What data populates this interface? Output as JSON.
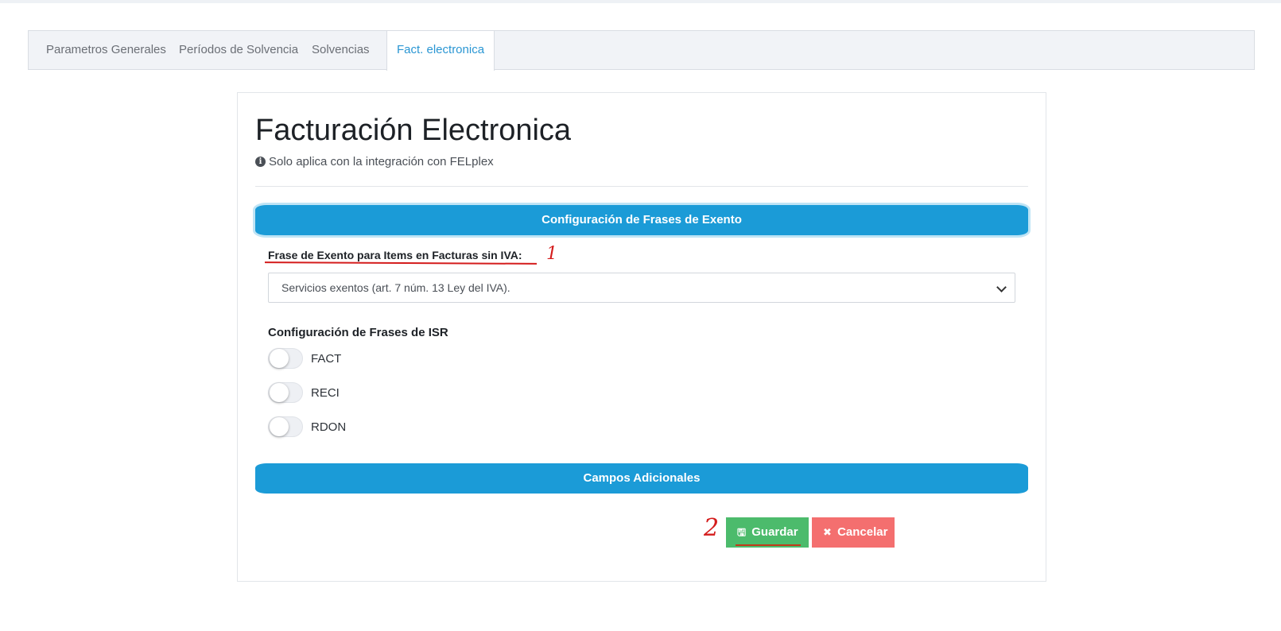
{
  "tabs": [
    {
      "label": "Parametros Generales",
      "active": false
    },
    {
      "label": "Períodos de Solvencia",
      "active": false
    },
    {
      "label": "Solvencias",
      "active": false
    },
    {
      "label": "Fact. electronica",
      "active": true
    }
  ],
  "page": {
    "title": "Facturación Electronica",
    "subtitle": "Solo aplica con la integración con FELplex",
    "info_icon": "info-circle-icon"
  },
  "exento_section": {
    "header": "Configuración de Frases de Exento",
    "field_label": "Frase de Exento para Items en Facturas sin IVA:",
    "selected_value": "Servicios exentos (art. 7 núm. 13 Ley del IVA).",
    "annotation_number": "1"
  },
  "isr_section": {
    "heading": "Configuración de Frases de ISR",
    "toggles": [
      {
        "label": "FACT",
        "on": false
      },
      {
        "label": "RECI",
        "on": false
      },
      {
        "label": "RDON",
        "on": false
      }
    ]
  },
  "additional_section": {
    "header": "Campos Adicionales"
  },
  "actions": {
    "save_label": "Guardar",
    "save_icon": "floppy-disk-icon",
    "cancel_label": "Cancelar",
    "cancel_icon": "close-icon",
    "annotation_number": "2"
  },
  "colors": {
    "accent": "#1b9bd7",
    "active_tab": "#2a96d3",
    "save": "#4cbb6c",
    "cancel": "#f46f6f",
    "annotation": "#d41c1c"
  }
}
